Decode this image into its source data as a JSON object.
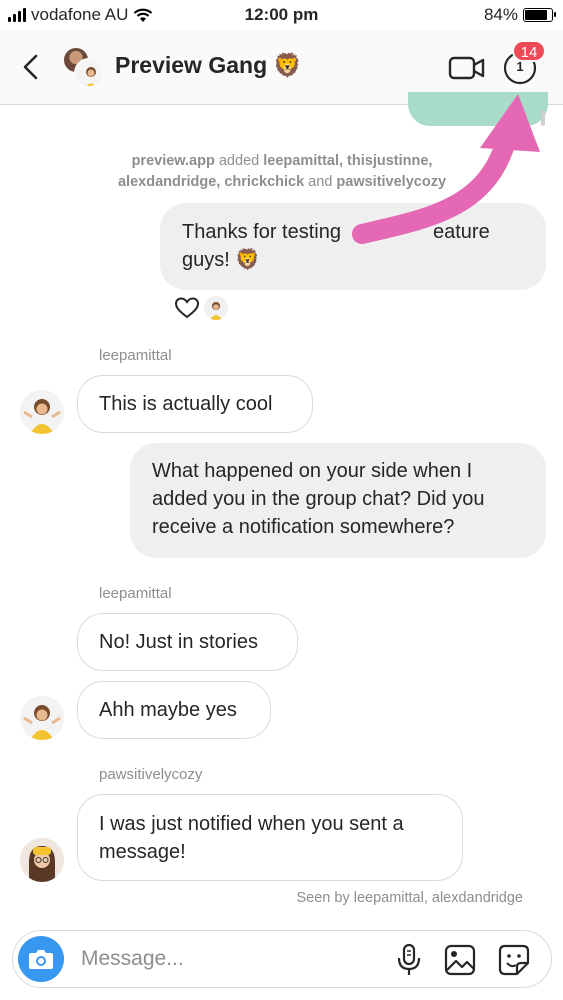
{
  "status_bar": {
    "carrier": "vodafone AU",
    "time": "12:00 pm",
    "battery_percent": "84%",
    "battery_level": 0.84
  },
  "header": {
    "title": "Preview Gang",
    "title_emoji": "🦁",
    "badge_count": "14",
    "info_count": "1"
  },
  "conversation": {
    "system_message": {
      "actor": "preview.app",
      "action": " added ",
      "members_part1": "leepamittal, thisjustinne,",
      "members_part2": "alexdandridge, chrickchick",
      "conjunction": " and ",
      "members_part3": "pawsitivelycozy"
    },
    "outgoing_1": {
      "text_part1": "Thanks for testing",
      "text_part2": "eature",
      "text_part3": "guys! 🦁"
    },
    "sender_1": "leepamittal",
    "incoming_1": "This is actually cool",
    "outgoing_2": "What happened on your side when I added you in the group chat? Did you receive a notification somewhere?",
    "sender_2": "leepamittal",
    "incoming_2": "No! Just in stories",
    "incoming_3": "Ahh maybe yes",
    "sender_3": "pawsitivelycozy",
    "incoming_4": "I was just notified when you sent a message!",
    "seen_by": "Seen by leepamittal, alexdandridge"
  },
  "composer": {
    "placeholder": "Message..."
  },
  "colors": {
    "accent_blue": "#3897f0",
    "badge_red": "#ed4956",
    "annotation_pink": "#e468b4",
    "teal_bubble": "#a8dcc9"
  },
  "icons": {
    "back": "chevron-left-icon",
    "video": "video-camera-icon",
    "info": "info-icon",
    "camera": "camera-icon",
    "mic": "microphone-icon",
    "gallery": "gallery-icon",
    "sticker": "sticker-icon",
    "heart": "heart-icon"
  }
}
